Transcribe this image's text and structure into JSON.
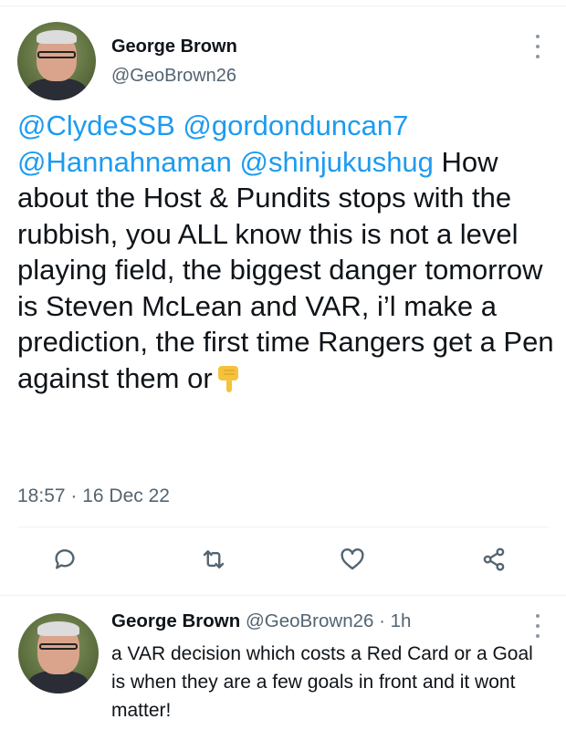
{
  "tweet": {
    "author_name": "George Brown",
    "author_handle": "@GeoBrown26",
    "mentions": [
      "@ClydeSSB",
      "@gordonduncan7",
      "@Hannahnaman",
      "@shinjukushug"
    ],
    "body": "How about the Host & Pundits stops with the rubbish, you ALL know this is not a level playing field, the biggest danger tomorrow is Steven McLean and VAR, i’l make a prediction, the first time Rangers get a Pen against them or",
    "emoji": "backhand-index-pointing-down",
    "timestamp": "18:57 · 16 Dec 22"
  },
  "actions": [
    {
      "name": "reply",
      "icon": "speech-bubble-icon"
    },
    {
      "name": "retweet",
      "icon": "retweet-icon"
    },
    {
      "name": "like",
      "icon": "heart-icon"
    },
    {
      "name": "share",
      "icon": "share-icon"
    }
  ],
  "reply": {
    "author_name": "George Brown",
    "meta": "@GeoBrown26 · 1h",
    "body": "a VAR decision which costs a Red Card or a Goal is when they are a few goals in front and it wont matter!"
  },
  "colors": {
    "link": "#1d9bf0",
    "text": "#0f1419",
    "secondary": "#536471",
    "icon": "#536471",
    "divider": "#eff3f4"
  }
}
